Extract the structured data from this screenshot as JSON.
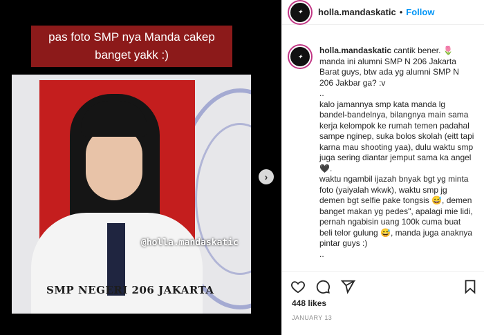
{
  "media": {
    "banner_text": "pas foto SMP nya Manda cakep banget yakk :)",
    "watermark": "@holla.mandaskatic",
    "school_label": "SMP NEGERI 206 JAKARTA"
  },
  "header": {
    "username": "holla.mandaskatic",
    "separator": "•",
    "follow_label": "Follow"
  },
  "caption": {
    "username": "holla.mandaskatic",
    "lines": [
      "cantik bener. 🌷",
      "manda ini alumni SMP N 206 Jakarta Barat guys, btw ada yg alumni SMP N 206 Jakbar ga? :v",
      "..",
      "kalo jamannya smp kata manda lg bandel-bandelnya, bilangnya main sama kerja kelompok ke rumah temen padahal sampe nginep, suka bolos skolah (eitt tapi karna mau shooting yaa), dulu waktu smp juga sering diantar jemput sama ka angel 🖤.",
      "waktu ngambil ijazah bnyak bgt yg minta foto (yaiyalah wkwk), waktu smp jg demen bgt selfie pake tongsis 😅, demen banget makan yg pedes\", apalagi mie lidi, pernah ngabisin uang 100k cuma buat beli telor gulung 😅, manda juga anaknya pintar guys :)",
      ".."
    ]
  },
  "footer": {
    "likes": "448 likes",
    "date": "JANUARY 13"
  },
  "icons": {
    "next": "chevron-right-icon",
    "like": "heart-icon",
    "comment": "comment-icon",
    "share": "paper-plane-icon",
    "save": "bookmark-icon"
  },
  "colors": {
    "banner": "#8c1a1a",
    "follow": "#0095f6",
    "photo_background": "#c41e1e"
  }
}
